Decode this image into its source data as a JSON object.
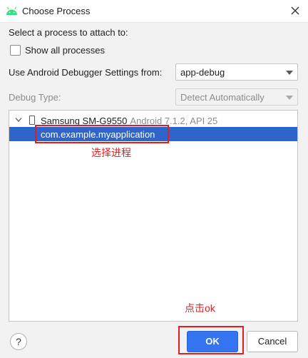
{
  "window": {
    "title": "Choose Process",
    "icon": "android-icon",
    "close_icon": "close-icon"
  },
  "form": {
    "attach_label": "Select a process to attach to:",
    "show_all_label": "Show all processes",
    "show_all_checked": false,
    "debugger_settings_label": "Use Android Debugger Settings from:",
    "debugger_settings_value": "app-debug",
    "debug_type_label": "Debug Type:",
    "debug_type_value": "Detect Automatically"
  },
  "tree": {
    "device_name": "Samsung SM-G9550",
    "device_info": "Android 7.1.2, API 25",
    "process": "com.example.myapplication"
  },
  "annotations": {
    "select_process": "选择进程",
    "click_ok": "点击ok",
    "color": "#e02020"
  },
  "footer": {
    "help_label": "?",
    "ok_label": "OK",
    "cancel_label": "Cancel"
  },
  "colors": {
    "accent": "#3574f0",
    "selection": "#2f65ca"
  }
}
